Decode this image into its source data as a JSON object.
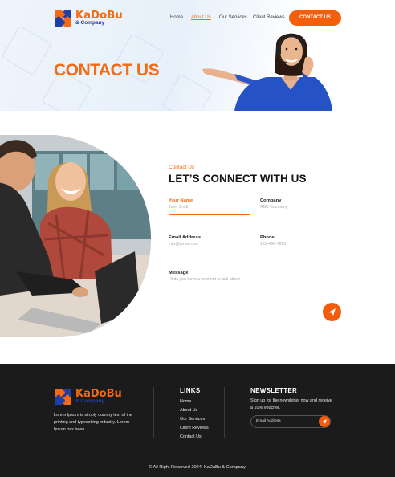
{
  "brand": {
    "name": "KaDoBu",
    "tagline": "& Company",
    "colors": {
      "accent": "#f56a12",
      "brand_blue": "#1f3fa8",
      "footer_bg": "#1b1b1b"
    }
  },
  "nav": {
    "items": [
      {
        "label": "Home",
        "active": false
      },
      {
        "label": "About Us",
        "active": true
      },
      {
        "label": "Our Services",
        "active": false
      },
      {
        "label": "Client Reviews",
        "active": false
      }
    ],
    "cta_label": "CONTACT US"
  },
  "hero": {
    "title": "CONTACT US"
  },
  "contact": {
    "kicker": "Contact Us",
    "title": "LET’S CONNECT WITH US",
    "fields": {
      "name": {
        "label": "Your Name",
        "placeholder": "John Smith"
      },
      "company": {
        "label": "Company",
        "placeholder": "ABC Company"
      },
      "email": {
        "label": "Email Address",
        "placeholder": "info@gmail.com"
      },
      "phone": {
        "label": "Phone",
        "placeholder": "123-456-7890"
      },
      "message": {
        "label": "Message",
        "placeholder": "Hi do you have a moment to talk about"
      }
    },
    "send_icon": "paper-plane-icon"
  },
  "footer": {
    "about": "Lorem Ipsum is simply dummy text of the printing and typesetting industry. Lorem Ipsum has been..",
    "links_title": "LINKS",
    "links": [
      "Home",
      "About Us",
      "Our Services",
      "Client Reviews",
      "Contact Us"
    ],
    "newsletter_title": "NEWSLETTER",
    "newsletter_text": "Sign up for the newsletter now and receive a 10% voucher.",
    "newsletter_placeholder": "Email Address",
    "copyright": "© All Right Reserved 2024. KaDaBu & Company."
  }
}
